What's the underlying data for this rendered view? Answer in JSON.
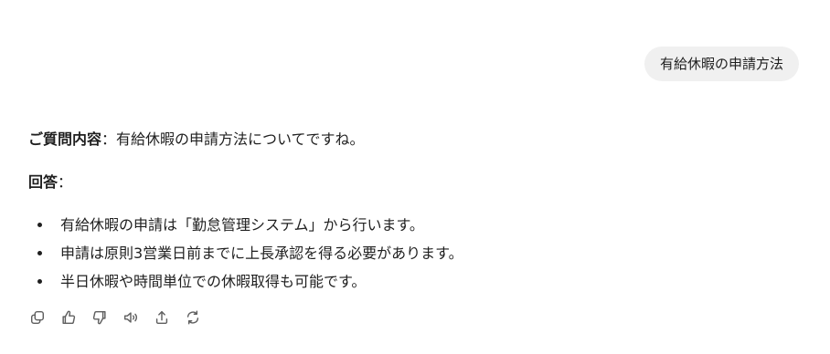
{
  "user_message": {
    "text": "有給休暇の申請方法"
  },
  "answer": {
    "question_label": "ご質問内容",
    "question_sep": "：",
    "question_text": "有給休暇の申請方法についてですね。",
    "answer_label": "回答",
    "answer_sep": "：",
    "bullets": [
      "有給休暇の申請は「勤怠管理システム」から行います。",
      "申請は原則3営業日前までに上長承認を得る必要があります。",
      "半日休暇や時間単位での休暇取得も可能です。"
    ]
  },
  "actions": [
    {
      "icon": "copy-icon"
    },
    {
      "icon": "thumbs-up-icon"
    },
    {
      "icon": "thumbs-down-icon"
    },
    {
      "icon": "read-aloud-icon"
    },
    {
      "icon": "share-icon"
    },
    {
      "icon": "regenerate-icon"
    }
  ],
  "colors": {
    "bubble_bg": "#f0f0f0",
    "text": "#1f1f1f",
    "icon": "#5f5f5f"
  }
}
